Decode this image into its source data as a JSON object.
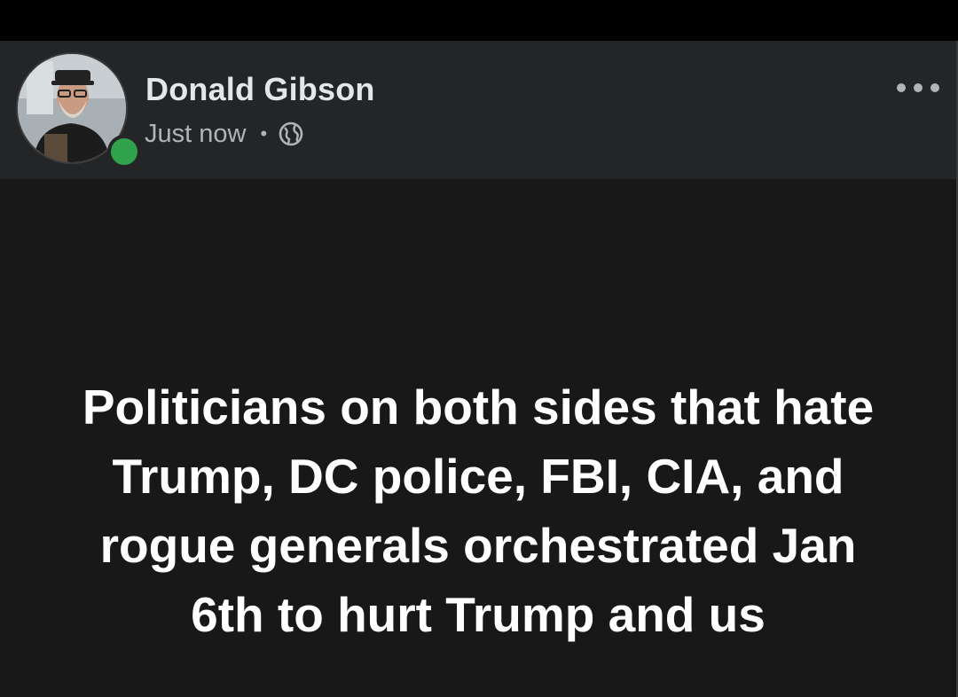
{
  "post": {
    "author_name": "Donald Gibson",
    "timestamp": "Just now",
    "separator": "•",
    "privacy_icon": "globe-icon",
    "more_options_icon": "more-horizontal-icon",
    "text_lines": [
      "Politicians on both sides that hate",
      "Trump, DC police, FBI, CIA, and",
      "rogue generals orchestrated Jan",
      "6th to hurt Trump and us"
    ]
  },
  "colors": {
    "header_bg": "#242526",
    "body_bg": "#181818",
    "online_status": "#31a24c",
    "name_text": "#e4e6eb",
    "meta_text": "#b0b3b8",
    "post_text": "#ffffff"
  }
}
